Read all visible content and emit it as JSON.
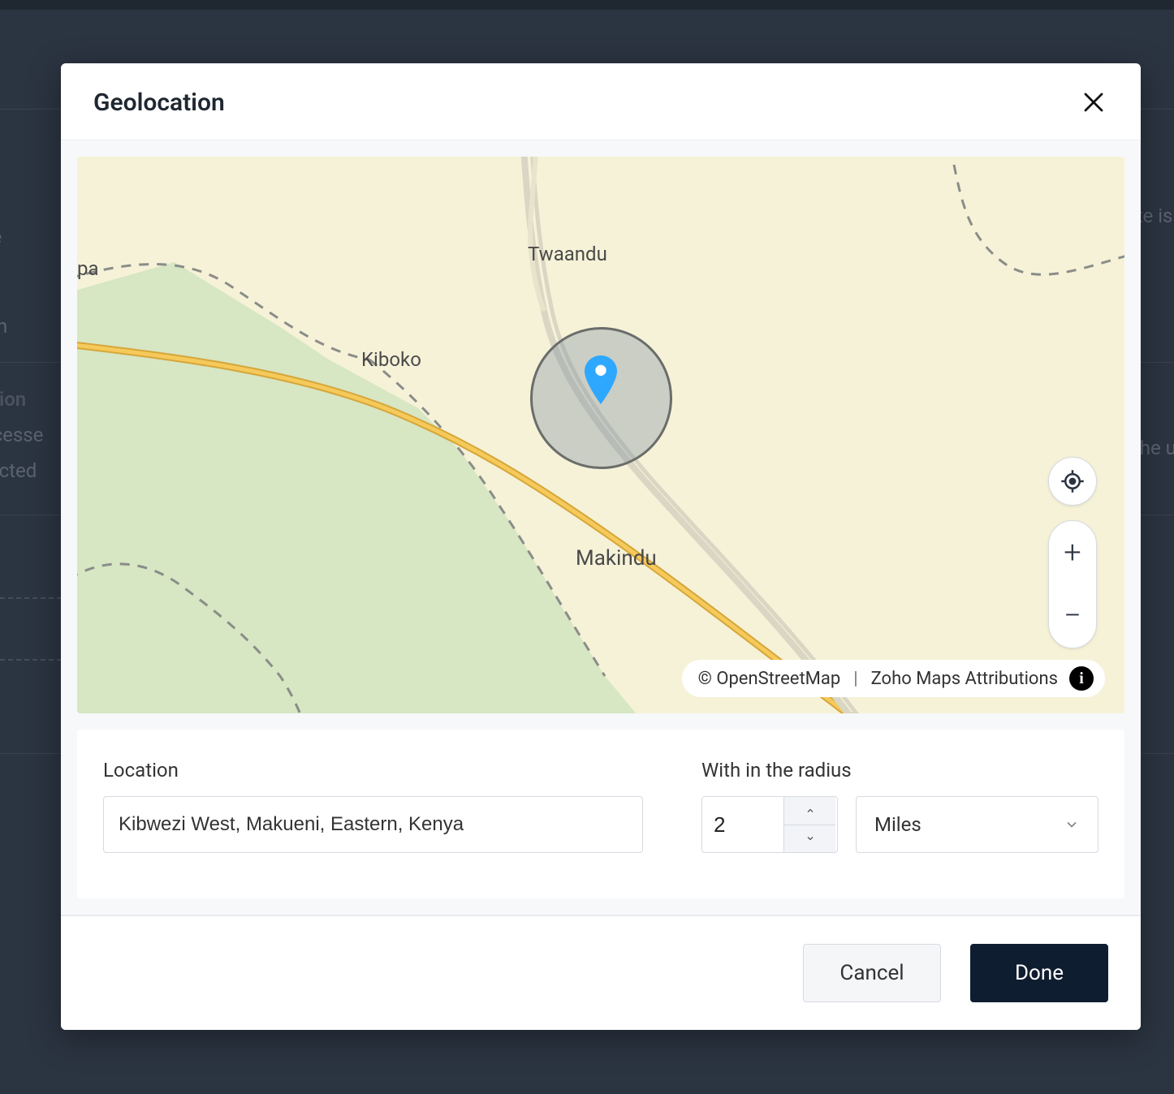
{
  "background": {
    "text1": "ole",
    "text2": "n",
    "text3": "ation",
    "text4": "ccesse",
    "text5": "tected",
    "text6": "te is pr",
    "text7": "he use"
  },
  "modal": {
    "title": "Geolocation",
    "map": {
      "labels": {
        "twaandu": "Twaandu",
        "kiboko": "Kiboko",
        "makindu": "Makindu",
        "pa": "pa"
      },
      "attribution": {
        "osm": "© OpenStreetMap",
        "sep": "|",
        "zoho": "Zoho Maps Attributions"
      },
      "controls": {
        "zoom_in": "+",
        "zoom_out": "−"
      }
    },
    "form": {
      "location_label": "Location",
      "location_value": "Kibwezi West, Makueni, Eastern, Kenya",
      "radius_label": "With in the radius",
      "radius_value": "2",
      "unit_value": "Miles"
    },
    "footer": {
      "cancel": "Cancel",
      "done": "Done"
    }
  }
}
